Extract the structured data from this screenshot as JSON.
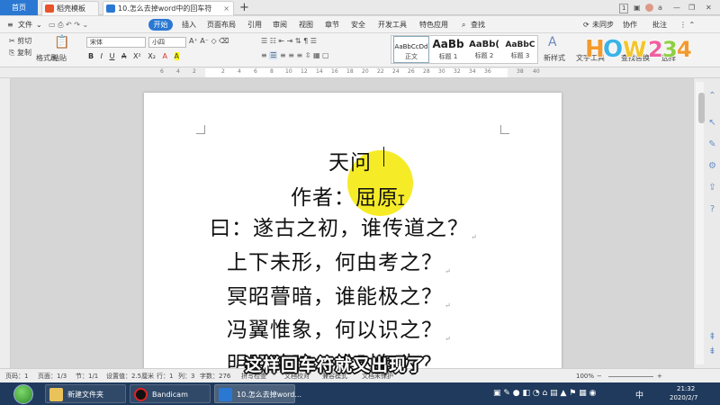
{
  "tabs": {
    "home": "首页",
    "template": "稻壳模板",
    "doc": "10.怎么去掉word中的回车符",
    "add": "+"
  },
  "topbar": {
    "badge": "1",
    "user": "a"
  },
  "menu": {
    "file": "文件",
    "start": "开始",
    "items": [
      "插入",
      "页面布局",
      "引用",
      "审阅",
      "视图",
      "章节",
      "安全",
      "开发工具",
      "特色应用"
    ],
    "search": "查找",
    "unsynced": "未同步",
    "collab": "协作",
    "annot": "批注"
  },
  "ribbon": {
    "cut": "剪切",
    "copy": "复制",
    "paste": "粘贴",
    "format_painter": "格式刷",
    "font_name": "宋体",
    "font_size": "小四",
    "fmt_buttons": [
      "B",
      "I",
      "U",
      "A",
      "X²",
      "X₂",
      "A",
      "A"
    ],
    "new_style": "新样式",
    "text_tools": "文字工具",
    "find_replace": "查找替换",
    "select": "选择",
    "styles": [
      {
        "preview": "AaBbCcDd",
        "label": "正文"
      },
      {
        "preview": "AaBb",
        "label": "标题 1"
      },
      {
        "preview": "AaBb(",
        "label": "标题 2"
      },
      {
        "preview": "AaBbC",
        "label": "标题 3"
      }
    ],
    "logo_text": "HOW234"
  },
  "ruler": {
    "numbers": [
      "6",
      "4",
      "2",
      "2",
      "4",
      "6",
      "8",
      "10",
      "12",
      "14",
      "16",
      "18",
      "20",
      "22",
      "24",
      "26",
      "28",
      "30",
      "32",
      "34",
      "36",
      "38",
      "40"
    ]
  },
  "document": {
    "lines": [
      "天问",
      "作者：屈原",
      "曰：遂古之初，谁传道之？",
      "上下未形，何由考之？",
      "冥昭瞢暗，谁能极之？",
      "冯翼惟象，何以识之？",
      "明明暗暗，惟时何为？"
    ],
    "para_mark": "↵"
  },
  "status": {
    "page_num": "页码：1",
    "page": "页面：1/3",
    "section": "节：1/1",
    "setting": "设置值：2.5厘米",
    "row": "行：1",
    "col": "列：3",
    "words": "字数：276",
    "spell": "拼写检查",
    "doc_check": "文档校对",
    "compat": "兼容模式",
    "protect": "文档未保护",
    "zoom": "100%"
  },
  "subtitle": "这样回车符就又出现了",
  "taskbar": {
    "items": [
      "新建文件夹",
      "Bandicam",
      "10.怎么去掉word..."
    ],
    "time": "21:32",
    "date": "2020/2/7",
    "ime": "中"
  }
}
